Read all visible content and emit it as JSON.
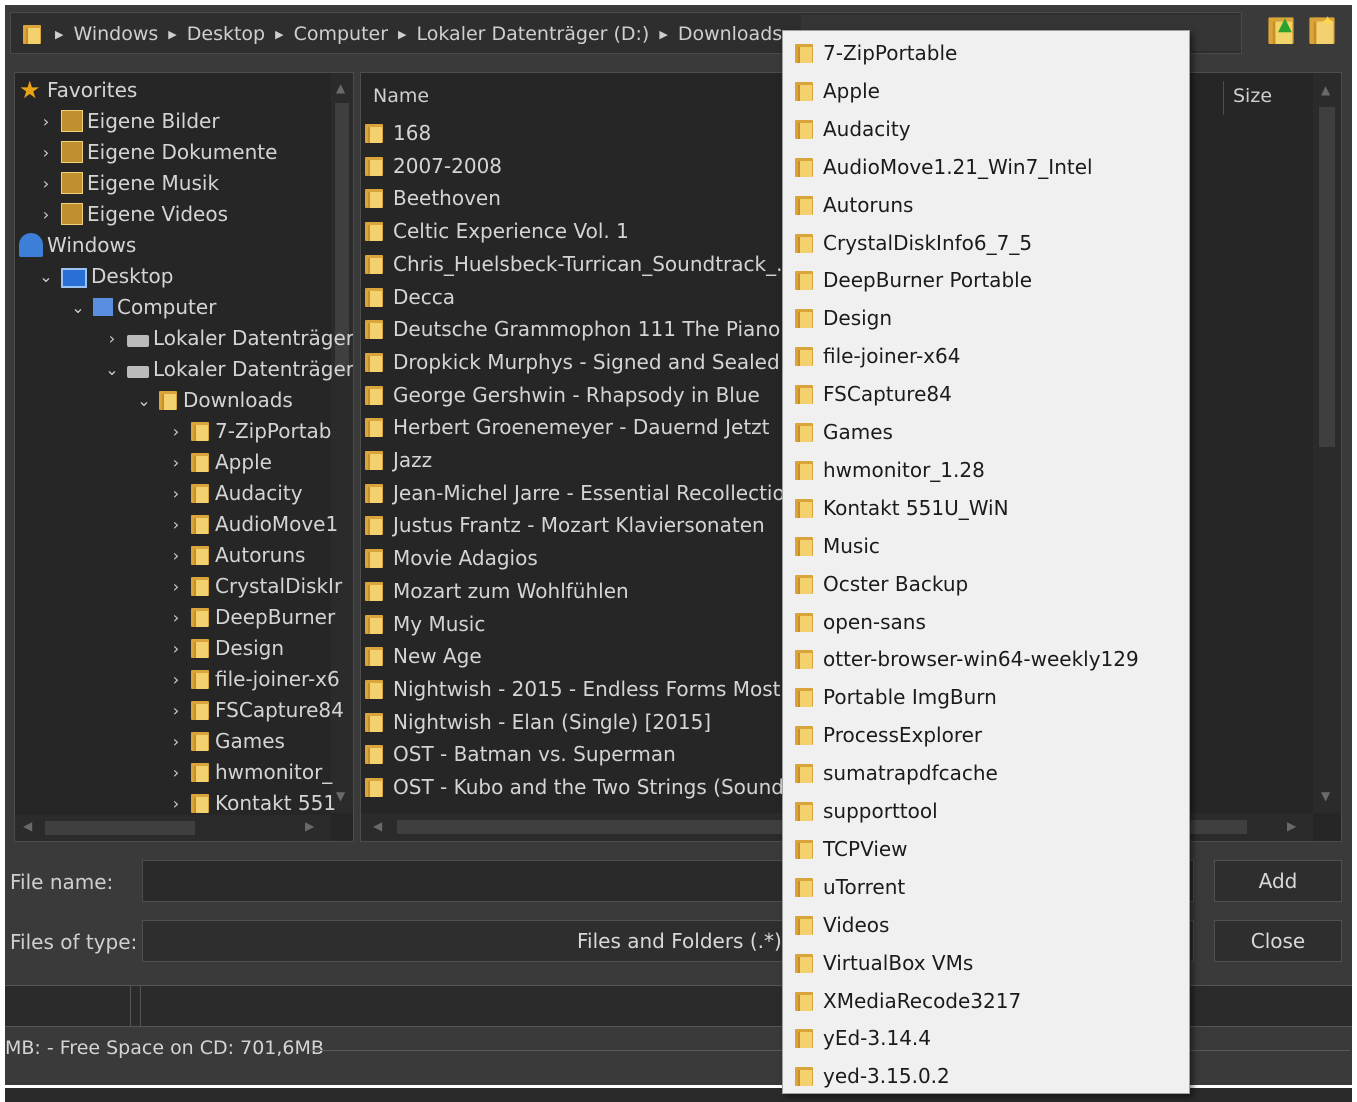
{
  "breadcrumb": [
    "Windows",
    "Desktop",
    "Computer",
    "Lokaler Datenträger (D:)",
    "Downloads"
  ],
  "tree": {
    "items": [
      {
        "label": "Favorites",
        "icon": "star-icon",
        "chevron": ""
      },
      {
        "label": "Eigene Bilder",
        "icon": "library-icon",
        "chevron": ">"
      },
      {
        "label": "Eigene Dokumente",
        "icon": "library-icon",
        "chevron": ">"
      },
      {
        "label": "Eigene Musik",
        "icon": "library-icon",
        "chevron": ">"
      },
      {
        "label": "Eigene Videos",
        "icon": "library-icon",
        "chevron": ">"
      },
      {
        "label": "Windows",
        "icon": "user-icon",
        "chevron": ""
      },
      {
        "label": "Desktop",
        "icon": "desktop-icon",
        "chevron": "v"
      },
      {
        "label": "Computer",
        "icon": "computer-icon",
        "chevron": "v"
      },
      {
        "label": "Lokaler Datenträger",
        "icon": "drive-icon",
        "chevron": ">"
      },
      {
        "label": "Lokaler Datenträger",
        "icon": "drive-icon",
        "chevron": "v"
      },
      {
        "label": "Downloads",
        "icon": "folder-icon",
        "chevron": "v"
      },
      {
        "label": "7-ZipPortab",
        "icon": "folder-icon",
        "chevron": ">"
      },
      {
        "label": "Apple",
        "icon": "folder-icon",
        "chevron": ">"
      },
      {
        "label": "Audacity",
        "icon": "folder-icon",
        "chevron": ">"
      },
      {
        "label": "AudioMove1",
        "icon": "folder-icon",
        "chevron": ">"
      },
      {
        "label": "Autoruns",
        "icon": "folder-icon",
        "chevron": ">"
      },
      {
        "label": "CrystalDiskIr",
        "icon": "folder-icon",
        "chevron": ">"
      },
      {
        "label": "DeepBurner",
        "icon": "folder-icon",
        "chevron": ">"
      },
      {
        "label": "Design",
        "icon": "folder-icon",
        "chevron": ">"
      },
      {
        "label": "file-joiner-x6",
        "icon": "folder-icon",
        "chevron": ">"
      },
      {
        "label": "FSCapture84",
        "icon": "folder-icon",
        "chevron": ">"
      },
      {
        "label": "Games",
        "icon": "folder-icon",
        "chevron": ">"
      },
      {
        "label": "hwmonitor_",
        "icon": "folder-icon",
        "chevron": ">"
      },
      {
        "label": "Kontakt 551",
        "icon": "folder-icon",
        "chevron": ">"
      }
    ]
  },
  "list": {
    "header_name": "Name",
    "header_size": "Size",
    "items": [
      "168",
      "2007-2008",
      "Beethoven",
      "Celtic Experience Vol. 1",
      "Chris_Huelsbeck-Turrican_Soundtrack_...",
      "Decca",
      "Deutsche Grammophon 111 The Piano ...",
      "Dropkick Murphys - Signed and Sealed ...",
      "George Gershwin - Rhapsody in Blue",
      "Herbert Groenemeyer - Dauernd Jetzt",
      "Jazz",
      "Jean-Michel Jarre - Essential Recollectio...",
      "Justus Frantz - Mozart Klaviersonaten",
      "Movie Adagios",
      "Mozart zum Wohlfühlen",
      "My Music",
      "New Age",
      "Nightwish - 2015 - Endless Forms Most ...",
      "Nightwish - Elan (Single) [2015]",
      "OST - Batman vs. Superman",
      "OST - Kubo and the Two Strings (Sound..."
    ]
  },
  "form": {
    "file_name_label": "File name:",
    "file_name_value": "",
    "file_type_label": "Files of type:",
    "file_type_value": "Files and Folders (.*)",
    "add_label": "Add",
    "close_label": "Close"
  },
  "status": {
    "text": "MB: - Free Space on CD: 701,6MB"
  },
  "dropdown": {
    "items": [
      "7-ZipPortable",
      "Apple",
      "Audacity",
      "AudioMove1.21_Win7_Intel",
      "Autoruns",
      "CrystalDiskInfo6_7_5",
      "DeepBurner Portable",
      "Design",
      "file-joiner-x64",
      "FSCapture84",
      "Games",
      "hwmonitor_1.28",
      "Kontakt 551U_WiN",
      "Music",
      "Ocster Backup",
      "open-sans",
      "otter-browser-win64-weekly129",
      "Portable ImgBurn",
      "ProcessExplorer",
      "sumatrapdfcache",
      "supporttool",
      "TCPView",
      "uTorrent",
      "Videos",
      "VirtualBox VMs",
      "XMediaRecode3217",
      "yEd-3.14.4",
      "yed-3.15.0.2"
    ]
  },
  "colors": {
    "dialog_bg": "#3a3a3a",
    "panel_bg": "#262626",
    "text": "#d4d4d4",
    "folder_yellow": "#f4d16f",
    "dropdown_bg": "#f0f0f0"
  }
}
